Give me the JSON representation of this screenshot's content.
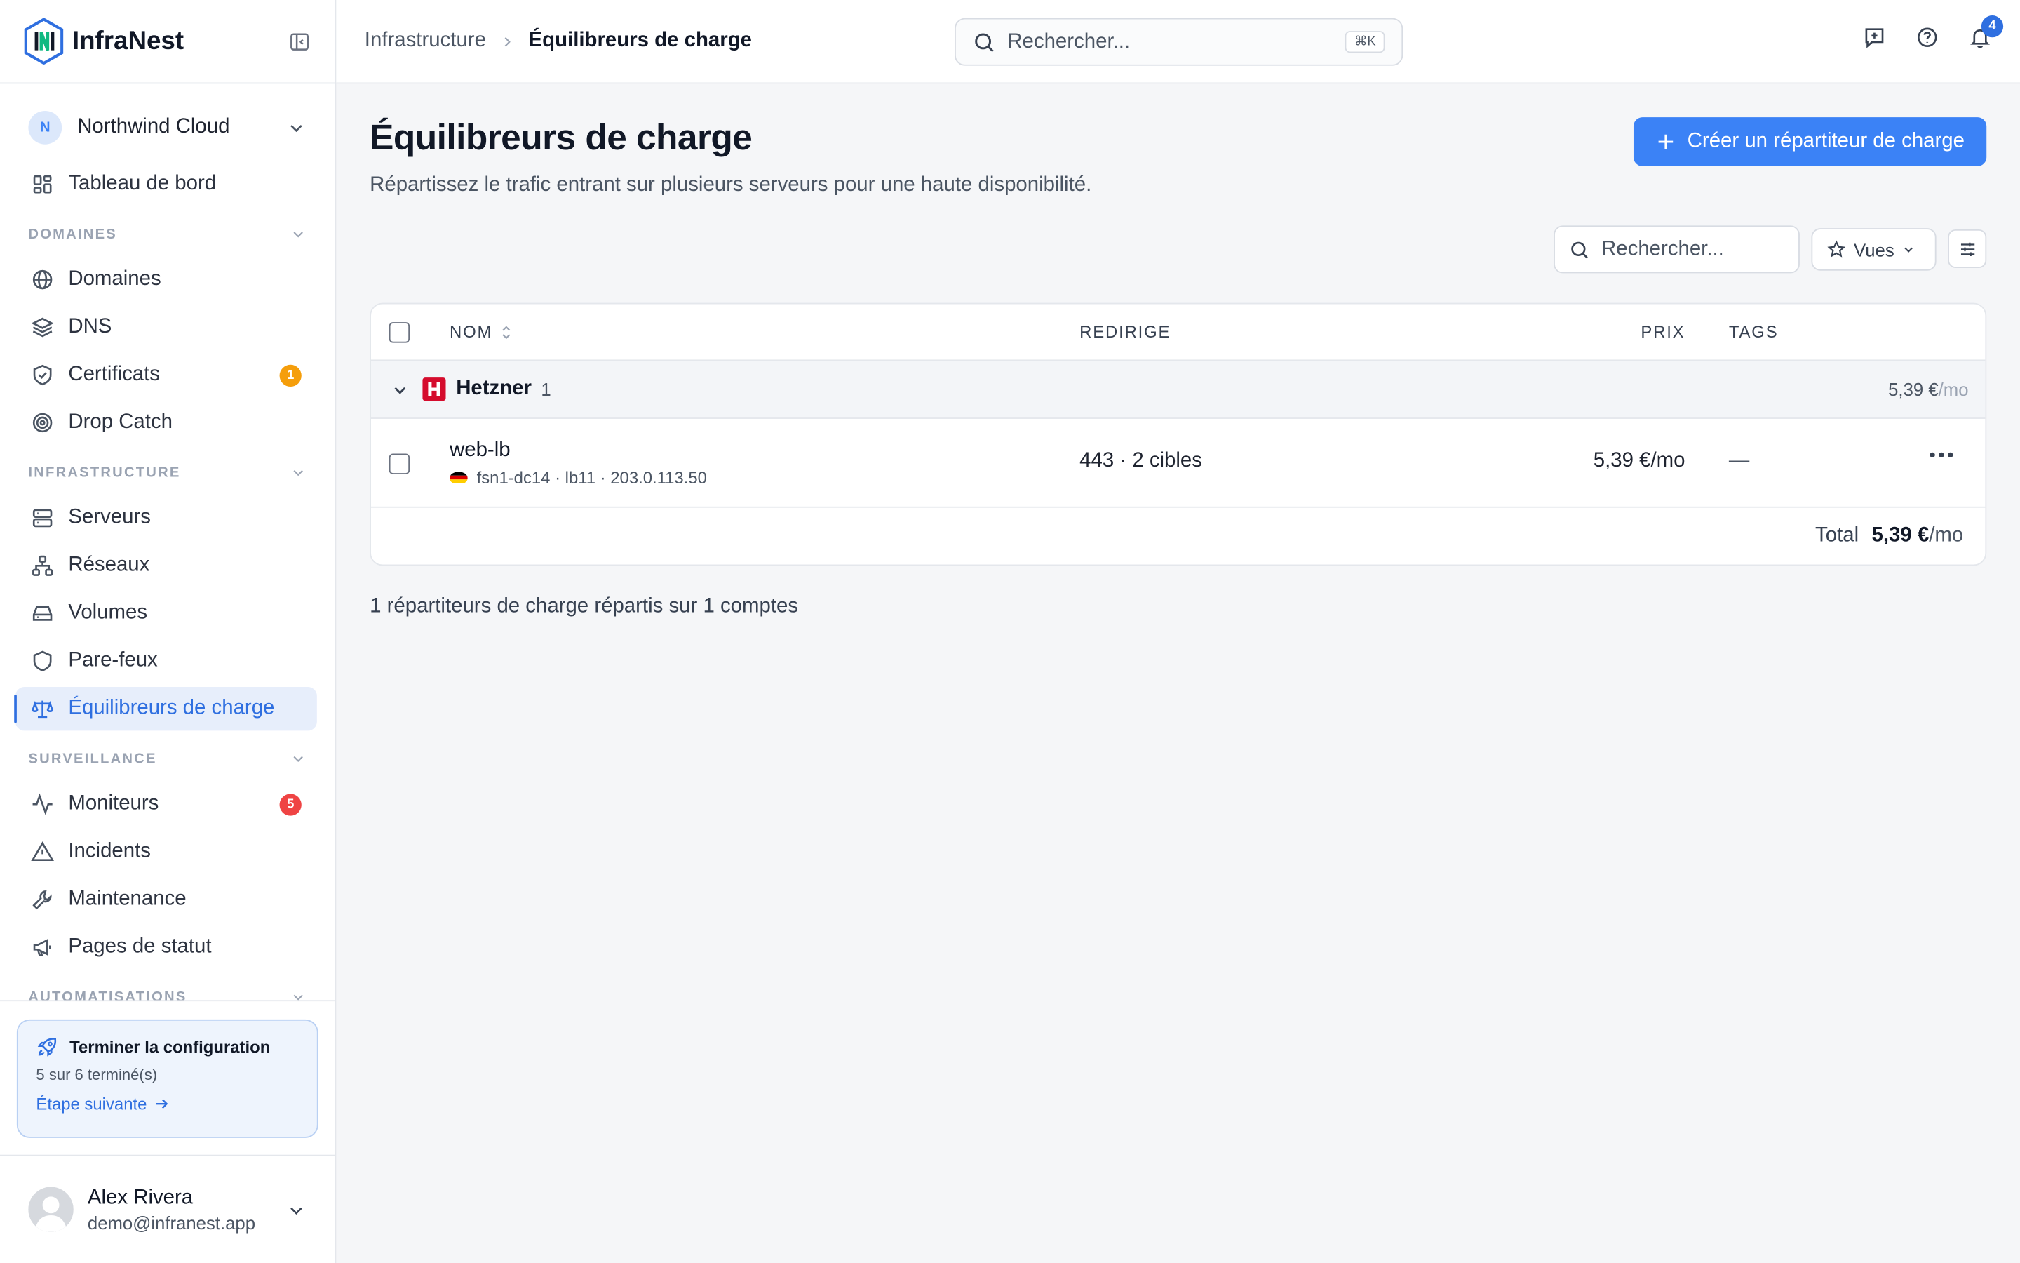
{
  "brand": {
    "name": "InfraNest"
  },
  "org": {
    "initial": "N",
    "name": "Northwind Cloud"
  },
  "nav": {
    "dashboard": "Tableau de bord",
    "sections": {
      "domaines": "DOMAINES",
      "infrastructure": "INFRASTRUCTURE",
      "surveillance": "SURVEILLANCE",
      "automatisations": "AUTOMATISATIONS"
    },
    "domaines": "Domaines",
    "dns": "DNS",
    "certificats": "Certificats",
    "certificats_badge": "1",
    "drop_catch": "Drop Catch",
    "serveurs": "Serveurs",
    "reseaux": "Réseaux",
    "volumes": "Volumes",
    "parefeux": "Pare-feux",
    "equilibreurs": "Équilibreurs de charge",
    "moniteurs": "Moniteurs",
    "moniteurs_badge": "5",
    "incidents": "Incidents",
    "maintenance": "Maintenance",
    "pages_statut": "Pages de statut"
  },
  "setup": {
    "title": "Terminer la configuration",
    "progress": "5 sur 6 terminé(s)",
    "next": "Étape suivante"
  },
  "user": {
    "name": "Alex Rivera",
    "email": "demo@infranest.app"
  },
  "breadcrumb": {
    "parent": "Infrastructure",
    "current": "Équilibreurs de charge"
  },
  "top_search": {
    "placeholder": "Rechercher...",
    "shortcut": "⌘K"
  },
  "notifications": {
    "count": "4"
  },
  "page": {
    "title": "Équilibreurs de charge",
    "subtitle": "Répartissez le trafic entrant sur plusieurs serveurs pour une haute disponibilité.",
    "create_label": "Créer un répartiteur de charge"
  },
  "toolbar": {
    "search_placeholder": "Rechercher...",
    "views_label": "Vues"
  },
  "table": {
    "columns": {
      "name": "NOM",
      "redirect": "REDIRIGE",
      "price": "PRIX",
      "tags": "TAGS"
    },
    "group": {
      "name": "Hetzner",
      "count": "1",
      "price": "5,39 €",
      "price_unit": "/mo"
    },
    "rows": [
      {
        "name": "web-lb",
        "meta": "fsn1-dc14 · lb11 · 203.0.113.50",
        "redirect": "443 · 2 cibles",
        "price": "5,39 €/mo",
        "tags": "—"
      }
    ],
    "total_label": "Total",
    "total_value": "5,39 €",
    "total_unit": "/mo"
  },
  "summary": "1 répartiteurs de charge répartis sur 1 comptes",
  "colors": {
    "accent": "#3b82f6",
    "active_bg": "#e7eefb",
    "hetzner": "#d50c2d"
  }
}
